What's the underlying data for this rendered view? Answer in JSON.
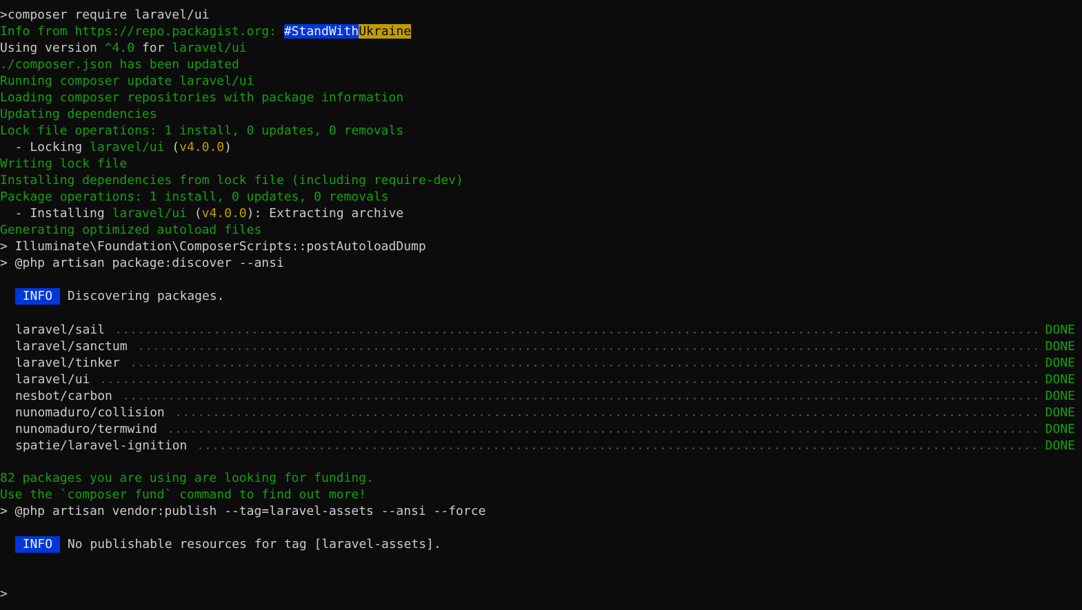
{
  "terminal": {
    "cmd": ">composer require laravel/ui",
    "info_from": "Info from https://repo.packagist.org: ",
    "stand_with": "#StandWith",
    "ukraine": "Ukraine",
    "using_version_prefix": "Using version ",
    "version_constraint": "^4.0",
    "using_version_for": " for ",
    "using_version_pkg": "laravel/ui",
    "composer_json_updated": "./composer.json has been updated",
    "running_update": "Running composer update laravel/ui",
    "loading_repos": "Loading composer repositories with package information",
    "updating_deps": "Updating dependencies",
    "lock_ops": "Lock file operations: 1 install, 0 updates, 0 removals",
    "locking_prefix": "  - Locking ",
    "locking_pkg": "laravel/ui",
    "locking_open": " (",
    "locking_version": "v4.0.0",
    "locking_close": ")",
    "writing_lock": "Writing lock file",
    "installing_deps": "Installing dependencies from lock file (including require-dev)",
    "package_ops": "Package operations: 1 install, 0 updates, 0 removals",
    "installing_prefix": "  - Installing ",
    "installing_pkg": "laravel/ui",
    "installing_open": " (",
    "installing_version": "v4.0.0",
    "installing_suffix": "): Extracting archive",
    "generating_autoload": "Generating optimized autoload files",
    "post_autoload": "> Illuminate\\Foundation\\ComposerScripts::postAutoloadDump",
    "package_discover": "> @php artisan package:discover --ansi",
    "info_badge_1": "INFO",
    "discovering": " Discovering packages.",
    "packages": [
      {
        "name": "laravel/sail",
        "status": "DONE"
      },
      {
        "name": "laravel/sanctum",
        "status": "DONE"
      },
      {
        "name": "laravel/tinker",
        "status": "DONE"
      },
      {
        "name": "laravel/ui",
        "status": "DONE"
      },
      {
        "name": "nesbot/carbon",
        "status": "DONE"
      },
      {
        "name": "nunomaduro/collision",
        "status": "DONE"
      },
      {
        "name": "nunomaduro/termwind",
        "status": "DONE"
      },
      {
        "name": "spatie/laravel-ignition",
        "status": "DONE"
      }
    ],
    "funding_1": "82 packages you are using are looking for funding.",
    "funding_2": "Use the `composer fund` command to find out more!",
    "vendor_publish": "> @php artisan vendor:publish --tag=laravel-assets --ansi --force",
    "info_badge_2": "INFO",
    "no_publishable": " No publishable resources for tag [laravel-assets].",
    "prompt": ">"
  },
  "colors": {
    "background": "#0c0c0c",
    "default_text": "#cccccc",
    "green": "#13a10e",
    "yellow": "#c19c00",
    "blue_badge": "#0037da"
  }
}
